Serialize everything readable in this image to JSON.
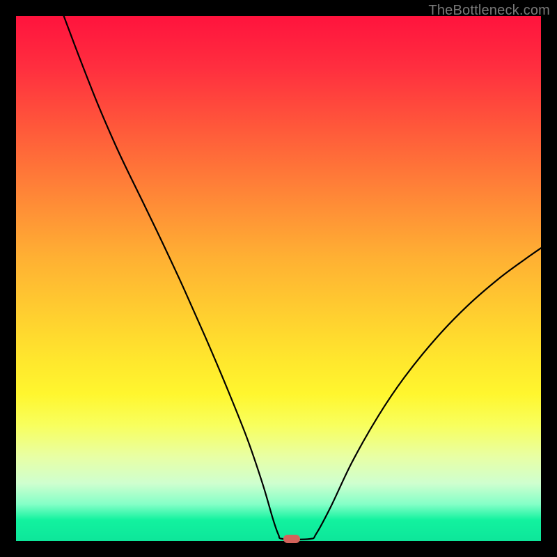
{
  "watermark": "TheBottleneck.com",
  "marker": {
    "x_norm": 0.525,
    "y_norm": 0.996
  },
  "chart_data": {
    "type": "line",
    "title": "",
    "xlabel": "",
    "ylabel": "",
    "xlim": [
      0,
      1
    ],
    "ylim": [
      0,
      1
    ],
    "series": [
      {
        "name": "curve",
        "description": "V-shaped bottleneck curve plotted over red-to-green vertical gradient",
        "points": [
          {
            "x": 0.091,
            "y": 1.0
          },
          {
            "x": 0.12,
            "y": 0.923
          },
          {
            "x": 0.155,
            "y": 0.834
          },
          {
            "x": 0.19,
            "y": 0.753
          },
          {
            "x": 0.215,
            "y": 0.7
          },
          {
            "x": 0.24,
            "y": 0.649
          },
          {
            "x": 0.28,
            "y": 0.566
          },
          {
            "x": 0.32,
            "y": 0.48
          },
          {
            "x": 0.36,
            "y": 0.39
          },
          {
            "x": 0.4,
            "y": 0.296
          },
          {
            "x": 0.44,
            "y": 0.196
          },
          {
            "x": 0.47,
            "y": 0.108
          },
          {
            "x": 0.49,
            "y": 0.04
          },
          {
            "x": 0.5,
            "y": 0.012
          },
          {
            "x": 0.508,
            "y": 0.004
          },
          {
            "x": 0.56,
            "y": 0.004
          },
          {
            "x": 0.572,
            "y": 0.014
          },
          {
            "x": 0.6,
            "y": 0.066
          },
          {
            "x": 0.64,
            "y": 0.15
          },
          {
            "x": 0.69,
            "y": 0.238
          },
          {
            "x": 0.74,
            "y": 0.312
          },
          {
            "x": 0.8,
            "y": 0.386
          },
          {
            "x": 0.86,
            "y": 0.448
          },
          {
            "x": 0.92,
            "y": 0.5
          },
          {
            "x": 0.97,
            "y": 0.537
          },
          {
            "x": 1.0,
            "y": 0.558
          }
        ]
      }
    ],
    "background_gradient": {
      "direction": "top-to-bottom",
      "stops": [
        {
          "pos": 0.0,
          "color": "#ff133d"
        },
        {
          "pos": 0.22,
          "color": "#ff5b3a"
        },
        {
          "pos": 0.46,
          "color": "#ffb033"
        },
        {
          "pos": 0.72,
          "color": "#fff62e"
        },
        {
          "pos": 0.89,
          "color": "#cfffcf"
        },
        {
          "pos": 1.0,
          "color": "#0de69a"
        }
      ]
    }
  }
}
